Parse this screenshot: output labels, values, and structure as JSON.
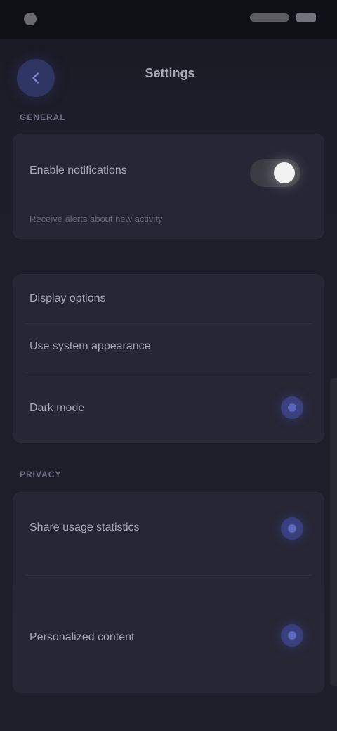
{
  "status_bar": {
    "time": "",
    "right_text": ""
  },
  "header": {
    "title": "Settings",
    "top_caption": ""
  },
  "sections": [
    {
      "label": "General",
      "items": [
        {
          "label": "Enable notifications",
          "sublabel": "Receive alerts about new activity",
          "control": "toggle",
          "state": "on"
        },
        {
          "label": "Display options",
          "sublabel": "",
          "control": "none"
        },
        {
          "label": "Use system appearance",
          "sublabel": "",
          "control": "none"
        },
        {
          "label": "Dark mode",
          "sublabel": "",
          "control": "radio",
          "state": "selected"
        }
      ]
    },
    {
      "label": "Privacy",
      "items": [
        {
          "label": "Share usage statistics",
          "sublabel": "",
          "control": "radio",
          "state": "selected"
        },
        {
          "label": "Personalized content",
          "sublabel": "",
          "control": "radio",
          "state": "selected"
        }
      ]
    }
  ],
  "colors": {
    "background": "#1f1f2b",
    "card": "#262635",
    "accent": "#3a3f7d",
    "toggle_knob": "#f2f2f2",
    "text_primary": "#a6a6b3",
    "text_secondary": "#656676"
  },
  "icons": {
    "back": "arrow-left-icon",
    "status": "status-dot-icon",
    "battery": "battery-icon"
  }
}
